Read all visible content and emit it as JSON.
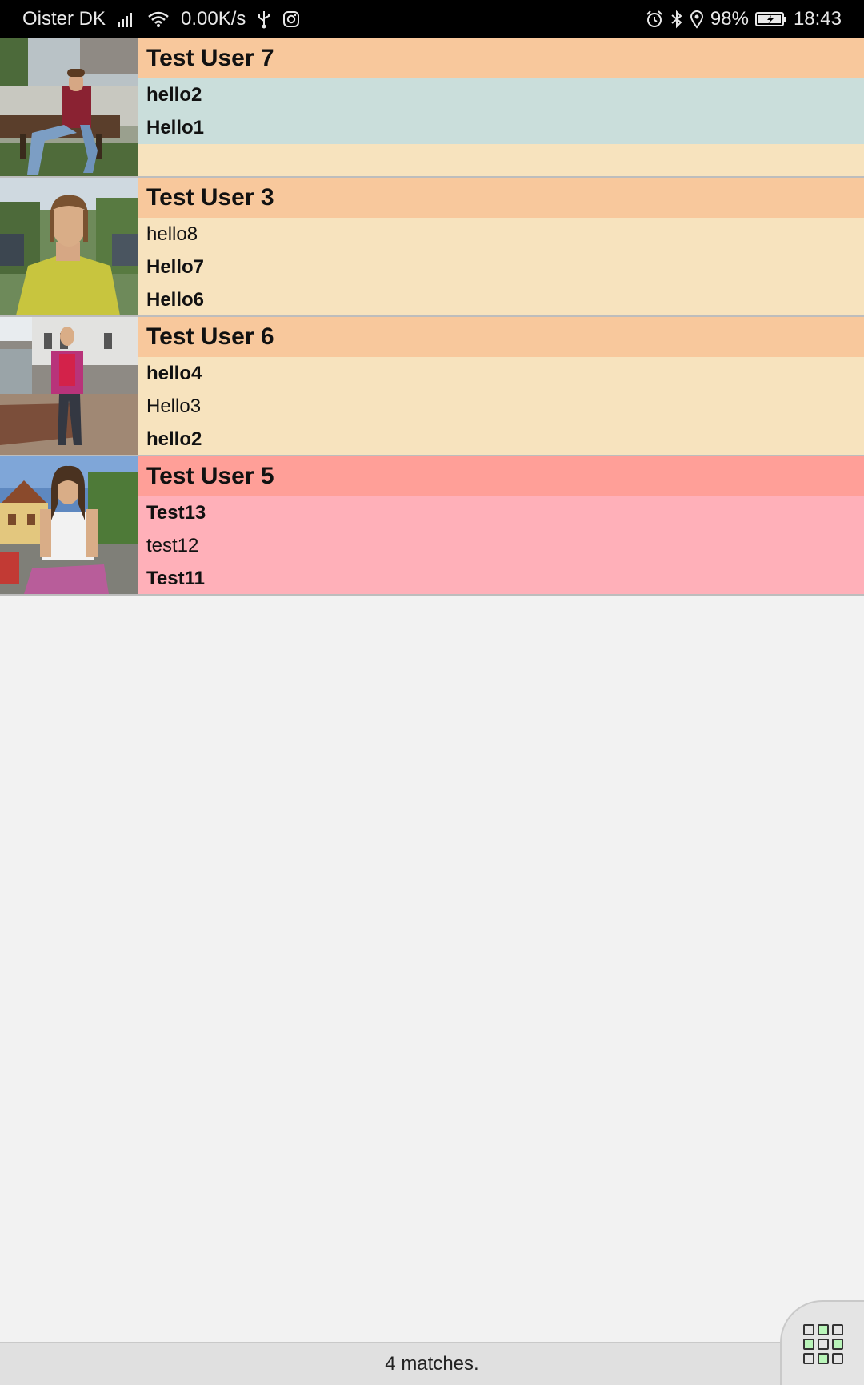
{
  "status_bar": {
    "carrier": "Oister DK",
    "net_speed": "0.00K/s",
    "battery": "98%",
    "time": "18:43"
  },
  "matches": [
    {
      "name": "Test User 7",
      "messages": [
        {
          "text": "hello2",
          "unread": true
        },
        {
          "text": "Hello1",
          "unread": true
        }
      ]
    },
    {
      "name": "Test User 3",
      "messages": [
        {
          "text": "hello8",
          "unread": false
        },
        {
          "text": "Hello7",
          "unread": true
        },
        {
          "text": "Hello6",
          "unread": true
        }
      ]
    },
    {
      "name": "Test User 6",
      "messages": [
        {
          "text": "hello4",
          "unread": true
        },
        {
          "text": "Hello3",
          "unread": false
        },
        {
          "text": "hello2",
          "unread": true
        }
      ]
    },
    {
      "name": "Test User 5",
      "messages": [
        {
          "text": "Test13",
          "unread": true
        },
        {
          "text": "test12",
          "unread": false
        },
        {
          "text": "Test11",
          "unread": true
        }
      ]
    }
  ],
  "footer": {
    "match_count": "4 matches."
  },
  "colors": {
    "card_header_orange": "#f8c89c",
    "card_body_beige": "#f7e3be",
    "card_message_blue": "#cadedb",
    "card_header_red": "#ff9f98",
    "card_body_pink": "#ffb0b9"
  }
}
